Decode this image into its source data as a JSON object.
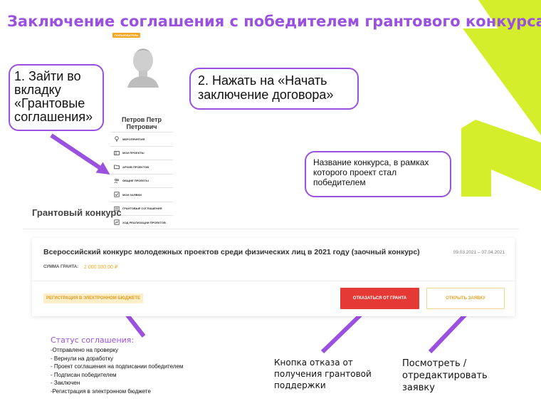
{
  "title": "Заключение соглашения с победителем грантового конкурса",
  "callouts": {
    "step1": "1. Зайти во вкладку «Грантовые соглашения»",
    "step2": "2. Нажать на «Начать заключение договора»",
    "contest_name_hint": "Название конкурса, в рамках которого проект стал победителем"
  },
  "profile": {
    "badge": "ПОЛЬЗОВАТЕЛЬ",
    "name": "Петров Петр Петрович",
    "menu": [
      {
        "icon": "lightbulb-icon",
        "label": "МЕРОПРИЯТИЯ"
      },
      {
        "icon": "folder-open-icon",
        "label": "МОИ ПРОЕКТЫ"
      },
      {
        "icon": "folder-icon",
        "label": "АРХИВ ПРОЕКТОВ"
      },
      {
        "icon": "people-icon",
        "label": "ОБЩИЕ ПРОЕКТЫ"
      },
      {
        "icon": "checkbox-icon",
        "label": "МОИ ЗАЯВКИ"
      },
      {
        "icon": "document-icon",
        "label": "ГРАНТОВЫЕ СОГЛАШЕНИЯ"
      },
      {
        "icon": "chart-icon",
        "label": "ХОД РЕАЛИЗАЦИИ ПРОЕКТОВ"
      }
    ]
  },
  "grant": {
    "section_title": "Грантовый конкурс",
    "contest_name": "Всероссийский конкурс молодежных проектов среди физических лиц в 2021 году (заочный конкурс)",
    "dates": "09.03.2021 – 07.04.2021",
    "sum_label": "СУММА ГРАНТА:",
    "sum_value": "2 000 000,00 ₽",
    "status": "РЕГИСТРАЦИЯ В ЭЛЕКТРОННОМ БЮДЖЕТЕ",
    "decline_button": "ОТКАЗАТЬСЯ ОТ ГРАНТА",
    "open_button": "ОТКРЫТЬ ЗАЯВКУ"
  },
  "status_notes": {
    "title": "Статус соглашения:",
    "items": [
      "-Отправлено на проверку",
      "- Вернули на доработку",
      "- Проект соглашения на подписании победителем",
      "- Подписан победителем",
      "- Заключен",
      "-Регистрация в электронном бюджете"
    ]
  },
  "notes": {
    "decline": "Кнопка отказа от получения грантовой поддержки",
    "open": "Посмотреть / отредактировать заявку"
  },
  "colors": {
    "accent": "#9b51e0",
    "lime": "#d4ee2c",
    "orange": "#f5a623",
    "red": "#e53935"
  }
}
